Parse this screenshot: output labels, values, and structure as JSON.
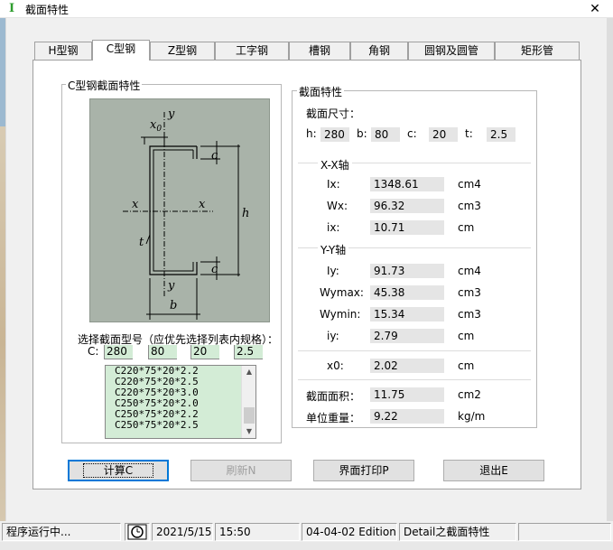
{
  "window": {
    "title": "截面特性",
    "app_icon_glyph": "I",
    "close_glyph": "✕"
  },
  "tabs": [
    {
      "label": "H型钢",
      "active": false
    },
    {
      "label": "C型钢",
      "active": true
    },
    {
      "label": "Z型钢",
      "active": false
    },
    {
      "label": "工字钢",
      "active": false
    },
    {
      "label": "槽钢",
      "active": false
    },
    {
      "label": "角钢",
      "active": false
    },
    {
      "label": "圆钢及圆管",
      "active": false
    },
    {
      "label": "矩形管",
      "active": false
    }
  ],
  "left_group": {
    "title": "C型钢截面特性",
    "diagram_labels": {
      "x0": "x",
      "x0_sub": "0",
      "y_top": "y",
      "c_top": "c",
      "x_left": "x",
      "x_right": "x",
      "h": "h",
      "t": "t",
      "c_bottom": "c",
      "y_bottom": "y",
      "b": "b"
    },
    "prompt": "选择截面型号（应优先选择列表内规格）：",
    "c_label": "C:",
    "c_values": [
      "280",
      "80",
      "20",
      "2.5"
    ],
    "list_items": [
      "C220*75*20*2.2",
      "C220*75*20*2.5",
      "C220*75*20*3.0",
      "C250*75*20*2.0",
      "C250*75*20*2.2",
      "C250*75*20*2.5"
    ]
  },
  "right_group": {
    "title": "截面特性",
    "dims_title": "截面尺寸：",
    "dims": [
      {
        "label": "h:",
        "value": "280"
      },
      {
        "label": "b:",
        "value": "80"
      },
      {
        "label": "c:",
        "value": "20"
      },
      {
        "label": "t:",
        "value": "2.5"
      }
    ],
    "xx_title": "X-X轴",
    "xx_props": [
      {
        "label": "Ix:",
        "value": "1348.61",
        "unit": "cm4"
      },
      {
        "label": "Wx:",
        "value": "96.32",
        "unit": "cm3"
      },
      {
        "label": "ix:",
        "value": "10.71",
        "unit": "cm"
      }
    ],
    "yy_title": "Y-Y轴",
    "yy_props": [
      {
        "label": "Iy:",
        "value": "91.73",
        "unit": "cm4"
      },
      {
        "label": "Wymax:",
        "value": "45.38",
        "unit": "cm3"
      },
      {
        "label": "Wymin:",
        "value": "15.34",
        "unit": "cm3"
      },
      {
        "label": "iy:",
        "value": "2.79",
        "unit": "cm"
      }
    ],
    "x0": {
      "label": "x0:",
      "value": "2.02",
      "unit": "cm"
    },
    "area": {
      "label": "截面面积：",
      "value": "11.75",
      "unit": "cm2"
    },
    "weight": {
      "label": "单位重量：",
      "value": "9.22",
      "unit": "kg/m"
    }
  },
  "buttons": {
    "calc": "计算C",
    "refresh": "刷新N",
    "print": "界面打印P",
    "exit": "退出E"
  },
  "statusbar": {
    "state": "程序运行中...",
    "icon": "clock-icon",
    "date": "2021/5/15",
    "time": "15:50",
    "edition": "04-04-02 Edition",
    "detail": "Detail之截面特性"
  }
}
